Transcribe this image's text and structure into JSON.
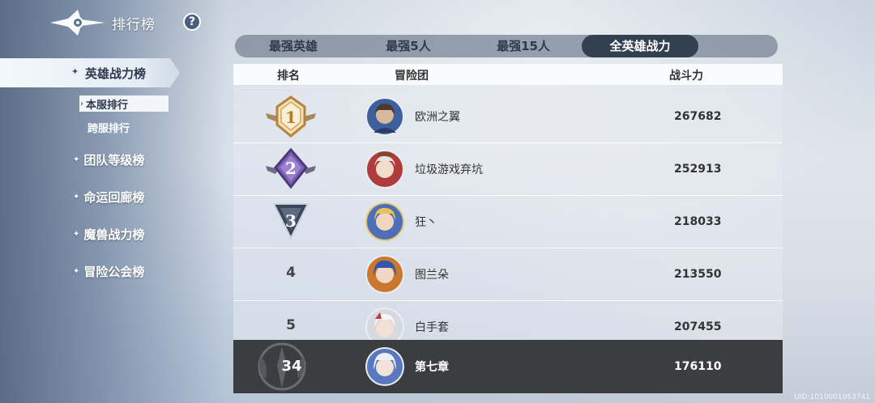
{
  "header": {
    "title": "排行榜",
    "help_icon": "question-icon",
    "help_label": "?"
  },
  "sidebar": {
    "active": {
      "label": "英雄战力榜",
      "marker": "✦"
    },
    "sub_items": [
      {
        "label": "本服排行",
        "marker": "›",
        "selected": true
      },
      {
        "label": "跨服排行",
        "selected": false
      }
    ],
    "items": [
      {
        "label": "团队等级榜",
        "marker": "✦"
      },
      {
        "label": "命运回廊榜",
        "marker": "✦"
      },
      {
        "label": "魔兽战力榜",
        "marker": "✦"
      },
      {
        "label": "冒险公会榜",
        "marker": "✦"
      }
    ]
  },
  "tabs": [
    {
      "label": "最强英雄",
      "active": false
    },
    {
      "label": "最强5人",
      "active": false
    },
    {
      "label": "最强15人",
      "active": false
    },
    {
      "label": "全英雄战力",
      "active": true
    }
  ],
  "table": {
    "columns": {
      "rank": "排名",
      "team": "冒险团",
      "power": "战斗力"
    },
    "rows": [
      {
        "rank": "1",
        "name": "欧洲之翼",
        "power": "267682",
        "badge": "gold"
      },
      {
        "rank": "2",
        "name": "垃圾游戏弃坑",
        "power": "252913",
        "badge": "purple"
      },
      {
        "rank": "3",
        "name": "狂丶",
        "power": "218033",
        "badge": "silver"
      },
      {
        "rank": "4",
        "name": "图兰朵",
        "power": "213550"
      },
      {
        "rank": "5",
        "name": "白手套",
        "power": "207455"
      }
    ],
    "self": {
      "rank": "34",
      "name": "第七章",
      "power": "176110"
    }
  },
  "colors": {
    "accent_dark": "#33404f",
    "gold": "#c8964a",
    "purple": "#6a4f9e"
  },
  "uid": "UID:1010001063741"
}
